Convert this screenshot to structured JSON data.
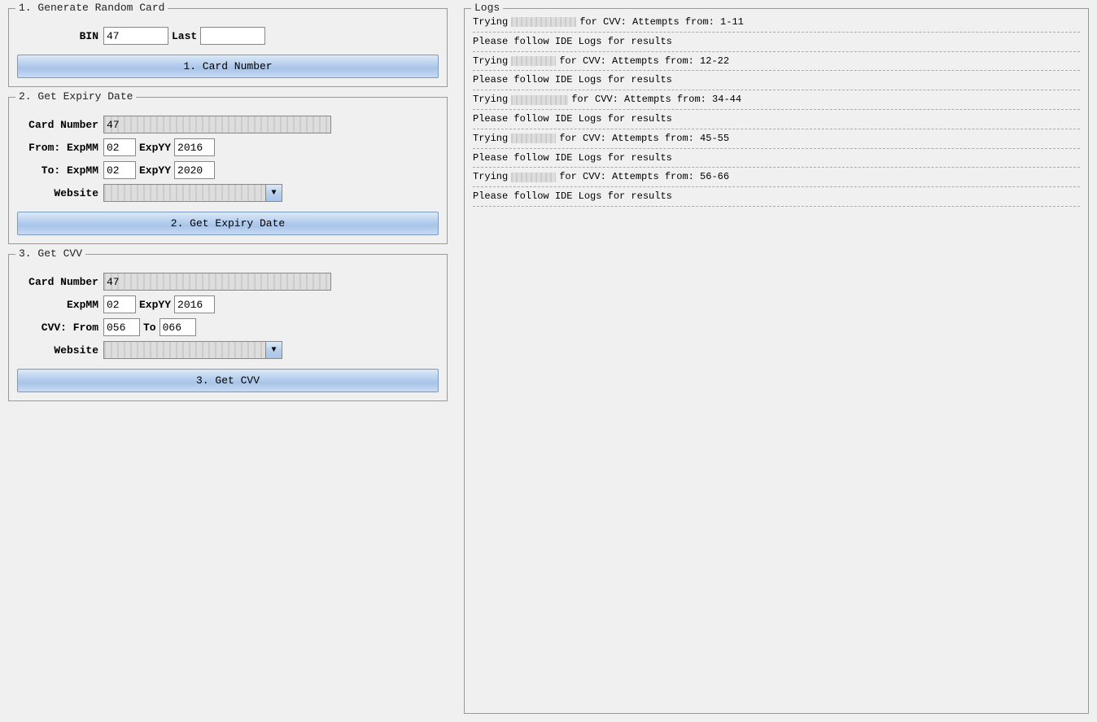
{
  "sections": {
    "section1": {
      "legend": "1. Generate Random Card",
      "bin_label": "BIN",
      "bin_value": "47",
      "last_label": "Last",
      "last_value": "",
      "button_label": "1.        Card Number"
    },
    "section2": {
      "legend": "2. Get Expiry Date",
      "card_label": "Card Number",
      "card_value": "47",
      "from_label": "From: ExpMM",
      "from_mm": "02",
      "from_yy_label": "ExpYY",
      "from_yy": "2016",
      "to_label": "To: ExpMM",
      "to_mm": "02",
      "to_yy_label": "ExpYY",
      "to_yy": "2020",
      "website_label": "Website",
      "website_value": "",
      "button_label": "2. Get Expiry Date"
    },
    "section3": {
      "legend": "3. Get CVV",
      "card_label": "Card Number",
      "card_value": "47",
      "expmm_label": "ExpMM",
      "expmm_value": "02",
      "expyy_label": "ExpYY",
      "expyy_value": "2016",
      "cvv_from_label": "CVV: From",
      "cvv_from_value": "056",
      "cvv_to_label": "To",
      "cvv_to_value": "066",
      "website_label": "Website",
      "website_value": "",
      "button_label": "3. Get CVV"
    },
    "logs": {
      "legend": "Logs",
      "entries": [
        {
          "type": "log",
          "prefix": "Trying",
          "masked": true,
          "masked_size": "large",
          "suffix": "for CVV: Attempts from: 1-11"
        },
        {
          "type": "separator"
        },
        {
          "type": "plain",
          "text": "Please follow IDE Logs for results"
        },
        {
          "type": "separator"
        },
        {
          "type": "log",
          "prefix": "Trying",
          "masked": true,
          "masked_size": "small",
          "suffix": "for CVV: Attempts from: 12-22"
        },
        {
          "type": "separator"
        },
        {
          "type": "plain",
          "text": "Please follow IDE Logs for results"
        },
        {
          "type": "separator"
        },
        {
          "type": "log",
          "prefix": "Trying",
          "masked": true,
          "masked_size": "medium",
          "suffix": "for CVV: Attempts from: 34-44"
        },
        {
          "type": "separator"
        },
        {
          "type": "plain",
          "text": "Please follow IDE Logs for results"
        },
        {
          "type": "separator"
        },
        {
          "type": "log",
          "prefix": "Trying",
          "masked": true,
          "masked_size": "small",
          "suffix": "for CVV: Attempts from: 45-55"
        },
        {
          "type": "separator"
        },
        {
          "type": "plain",
          "text": "Please follow IDE Logs for results"
        },
        {
          "type": "separator"
        },
        {
          "type": "log",
          "prefix": "Trying",
          "masked": true,
          "masked_size": "small",
          "suffix": "for CVV: Attempts from: 56-66"
        },
        {
          "type": "separator"
        },
        {
          "type": "plain",
          "text": "Please follow IDE Logs for results"
        },
        {
          "type": "separator"
        }
      ]
    }
  }
}
